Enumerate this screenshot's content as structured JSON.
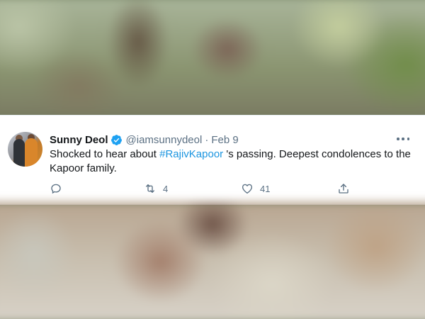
{
  "tweet": {
    "display_name": "Sunny Deol",
    "verified": true,
    "handle": "@iamsunnydeol",
    "separator": "·",
    "date": "Feb 9",
    "text_before": "Shocked to hear about ",
    "hashtag": "#RajivKapoor",
    "text_after": " 's passing. Deepest condolences to the Kapoor family.",
    "actions": {
      "reply_count": "",
      "retweet_count": "4",
      "like_count": "41"
    },
    "icons": {
      "verified": "verified-badge-icon",
      "more": "more-dots-icon",
      "reply": "reply-icon",
      "retweet": "retweet-icon",
      "like": "heart-icon",
      "share": "share-icon"
    }
  },
  "colors": {
    "text_primary": "#14171a",
    "text_secondary": "#5b7083",
    "hashtag": "#1b95e0",
    "verified": "#1da1f2",
    "card_background": "#ffffff"
  }
}
